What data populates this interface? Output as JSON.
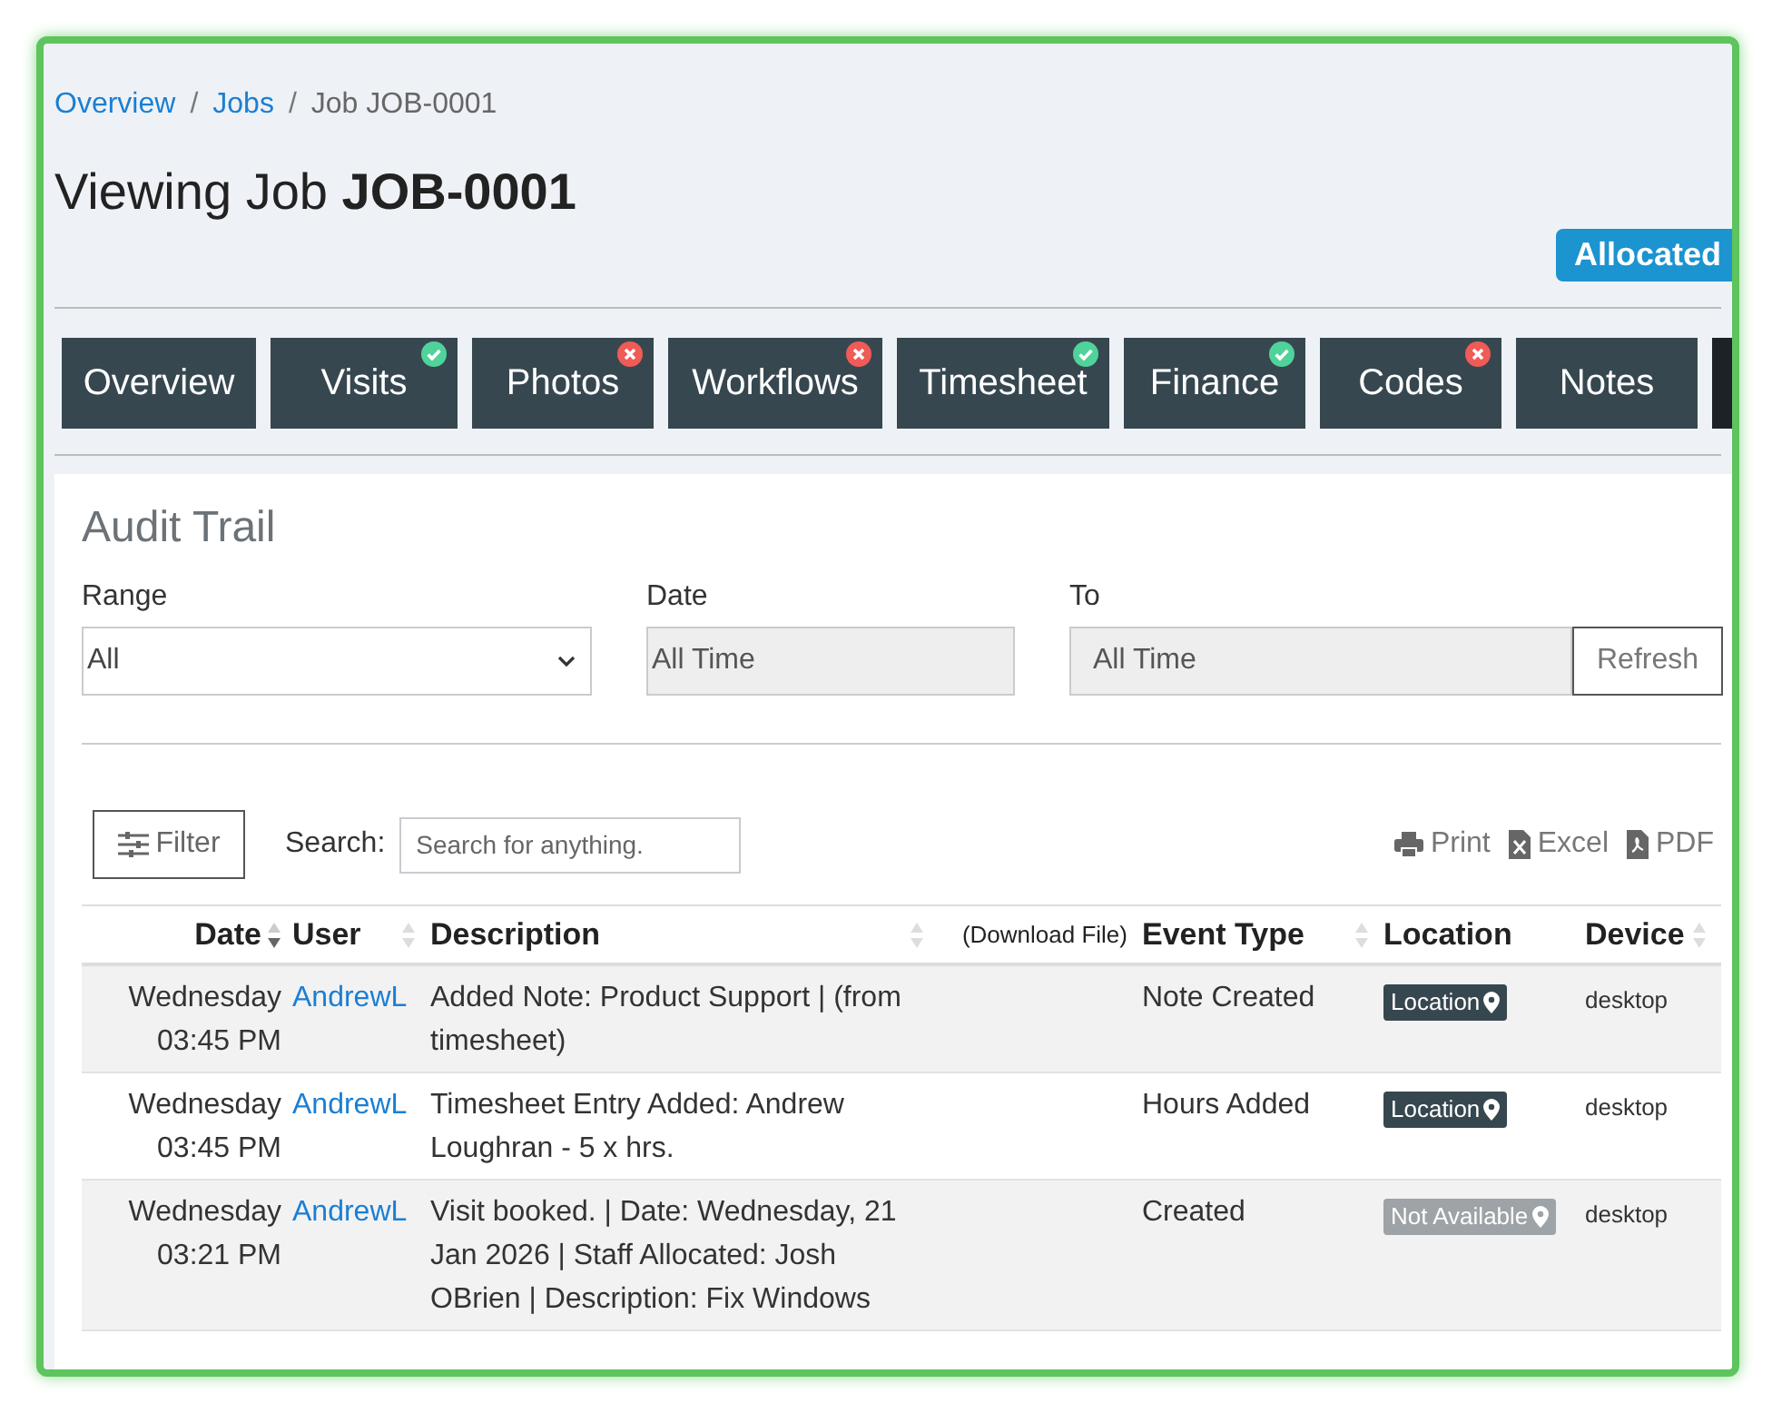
{
  "breadcrumb": [
    {
      "label": "Overview",
      "kind": "link"
    },
    {
      "label": "/",
      "kind": "separator"
    },
    {
      "label": "Jobs",
      "kind": "link"
    },
    {
      "label": "/",
      "kind": "separator"
    },
    {
      "label": "Job JOB-0001",
      "kind": "current"
    }
  ],
  "title": {
    "prefix": "Viewing Job",
    "job": "JOB-0001"
  },
  "status_badge": "Allocated",
  "tabs": [
    {
      "label": "Overview",
      "kind": "plain"
    },
    {
      "label": "Visits",
      "kind": "done"
    },
    {
      "label": "Photos",
      "kind": "missing"
    },
    {
      "label": "Workflows",
      "kind": "missing"
    },
    {
      "label": "Timesheet",
      "kind": "done"
    },
    {
      "label": "Finance",
      "kind": "done"
    },
    {
      "label": "Codes",
      "kind": "missing"
    },
    {
      "label": "Notes",
      "kind": "plain"
    }
  ],
  "audit": {
    "heading": "Audit Trail",
    "range": {
      "label": "Range",
      "value": "All"
    },
    "date": {
      "label": "Date",
      "value": "All Time"
    },
    "to": {
      "label": "To",
      "value": "All Time"
    },
    "refresh": "Refresh",
    "filter": "Filter",
    "search": {
      "label": "Search:",
      "placeholder": "Search for anything."
    },
    "exports": [
      {
        "kind": "print",
        "label": "Print"
      },
      {
        "kind": "excel",
        "label": "Excel"
      },
      {
        "kind": "pdf",
        "label": "PDF"
      }
    ],
    "columns": [
      "Date",
      "User",
      "Description",
      "(Download File)",
      "Event Type",
      "Location",
      "Device"
    ],
    "rows": [
      {
        "day": "Wednesday",
        "time": "03:45 PM",
        "user": "AndrewL",
        "description": "Added Note: Product Support | (from timesheet)",
        "event": "Note Created",
        "location": {
          "label": "Location",
          "available": true
        },
        "device": "desktop"
      },
      {
        "day": "Wednesday",
        "time": "03:45 PM",
        "user": "AndrewL",
        "description": "Timesheet Entry Added: Andrew Loughran - 5 x hrs.",
        "event": "Hours Added",
        "location": {
          "label": "Location",
          "available": true
        },
        "device": "desktop"
      },
      {
        "day": "Wednesday",
        "time": "03:21 PM",
        "user": "AndrewL",
        "description": "Visit booked. | Date: Wednesday, 21 Jan 2026 | Staff Allocated: Josh OBrien | Description: Fix Windows",
        "event": "Created",
        "location": {
          "label": "Not Available",
          "available": false
        },
        "device": "desktop"
      }
    ]
  }
}
